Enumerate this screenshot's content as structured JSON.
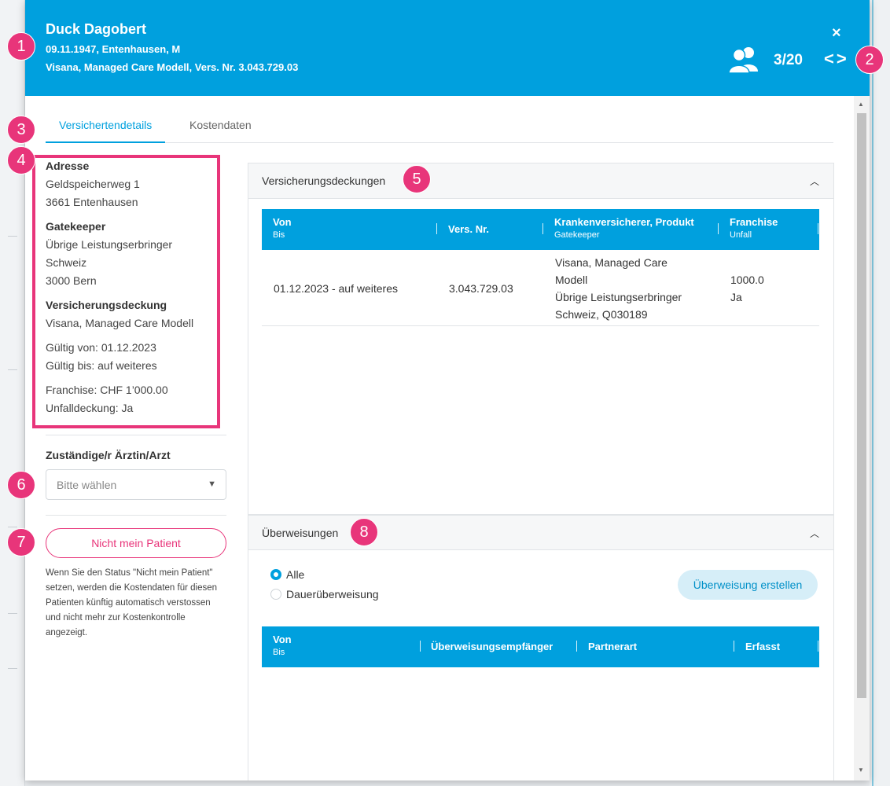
{
  "header": {
    "name": "Duck Dagobert",
    "line1": "09.11.1947, Entenhausen, M",
    "line2": "Visana, Managed Care Modell, Vers. Nr. 3.043.729.03",
    "close": "×",
    "counter": "3/20",
    "nav": "<>",
    "users_icon": "users-icon"
  },
  "tabs": [
    "Versichertendetails",
    "Kostendaten"
  ],
  "details": {
    "adresse_label": "Adresse",
    "adresse": [
      "Geldspeicherweg 1",
      "3661 Entenhausen"
    ],
    "gatekeeper_label": "Gatekeeper",
    "gatekeeper": [
      "Übrige Leistungserbringer",
      "Schweiz",
      "3000 Bern"
    ],
    "deckung_label": "Versicherungsdeckung",
    "deckung": "Visana, Managed Care Modell",
    "gueltig_von": "Gültig von: 01.12.2023",
    "gueltig_bis": "Gültig bis: auf weiteres",
    "franchise": "Franchise: CHF 1’000.00",
    "unfall": "Unfalldeckung: Ja"
  },
  "doctor": {
    "label": "Zuständige/r Ärztin/Arzt",
    "placeholder": "Bitte wählen"
  },
  "not_patient": {
    "button": "Nicht mein Patient",
    "description": "Wenn Sie den Status \"Nicht mein Patient\" setzen, werden die Kostendaten für diesen Patienten künftig automatisch verstossen und nicht mehr zur Kostenkontrolle angezeigt."
  },
  "coverage": {
    "title": "Versicherungsdeckungen",
    "columns": [
      {
        "main": "Von",
        "sub": "Bis"
      },
      {
        "main": "Vers. Nr.",
        "sub": ""
      },
      {
        "main": "Krankenversicherer, Produkt",
        "sub": "Gatekeeper"
      },
      {
        "main": "Franchise",
        "sub": "Unfall"
      }
    ],
    "row": {
      "period": "01.12.2023 - auf weiteres",
      "vers_nr": "3.043.729.03",
      "insurer": [
        "Visana, Managed Care",
        "Modell",
        "Übrige Leistungserbringer",
        "Schweiz, Q030189"
      ],
      "franchise": "1000.0",
      "unfall": "Ja"
    }
  },
  "referrals": {
    "title": "Überweisungen",
    "radio_all": "Alle",
    "radio_permanent": "Dauerüberweisung",
    "create_button": "Überweisung erstellen",
    "columns": [
      {
        "main": "Von",
        "sub": "Bis"
      },
      {
        "main": "Überweisungsempfänger",
        "sub": ""
      },
      {
        "main": "Partnerart",
        "sub": ""
      },
      {
        "main": "Erfasst",
        "sub": ""
      }
    ]
  },
  "badges": [
    "1",
    "2",
    "3",
    "4",
    "5",
    "6",
    "7",
    "8"
  ],
  "colors": {
    "accent": "#00a0de",
    "highlight": "#e8357a"
  }
}
